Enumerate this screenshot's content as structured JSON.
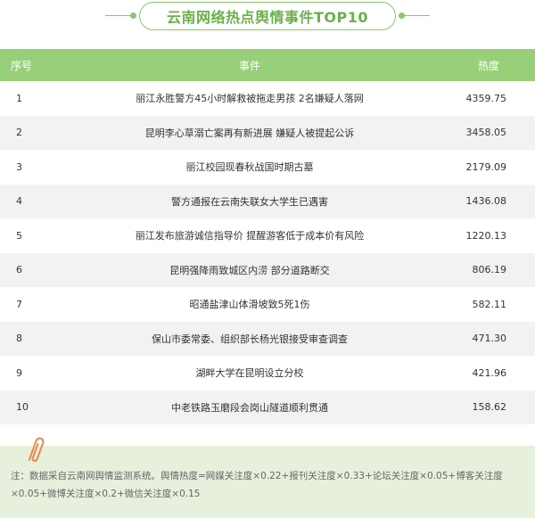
{
  "title": "云南网络热点舆情事件TOP10",
  "table": {
    "headers": {
      "index": "序号",
      "event": "事件",
      "heat": "热度"
    },
    "rows": [
      {
        "index": "1",
        "event": "丽江永胜警方45小时解救被拖走男孩 2名嫌疑人落网",
        "heat": "4359.75"
      },
      {
        "index": "2",
        "event": "昆明李心草溺亡案再有新进展 嫌疑人被提起公诉",
        "heat": "3458.05"
      },
      {
        "index": "3",
        "event": "丽江校园现春秋战国时期古墓",
        "heat": "2179.09"
      },
      {
        "index": "4",
        "event": "警方通报在云南失联女大学生已遇害",
        "heat": "1436.08"
      },
      {
        "index": "5",
        "event": "丽江发布旅游诚信指导价 提醒游客低于成本价有风险",
        "heat": "1220.13"
      },
      {
        "index": "6",
        "event": "昆明强降雨致城区内涝 部分道路断交",
        "heat": "806.19"
      },
      {
        "index": "7",
        "event": "昭通盐津山体滑坡致5死1伤",
        "heat": "582.11"
      },
      {
        "index": "8",
        "event": "保山市委常委、组织部长杨光银接受审查调查",
        "heat": "471.30"
      },
      {
        "index": "9",
        "event": "湖畔大学在昆明设立分校",
        "heat": "421.96"
      },
      {
        "index": "10",
        "event": "中老铁路玉磨段会岗山隧道顺利贯通",
        "heat": "158.62"
      }
    ]
  },
  "note": "注：数据采自云南网舆情监测系统。舆情热度=网媒关注度×0.22+报刊关注度×0.33+论坛关注度×0.05+博客关注度×0.05+微博关注度×0.2+微信关注度×0.15",
  "colors": {
    "accent": "#98d07a",
    "title_text": "#6ab04c",
    "note_bg": "#e6f0dc",
    "row_alt": "#f2f2f2"
  },
  "icons": {
    "note": "paperclip-icon"
  }
}
